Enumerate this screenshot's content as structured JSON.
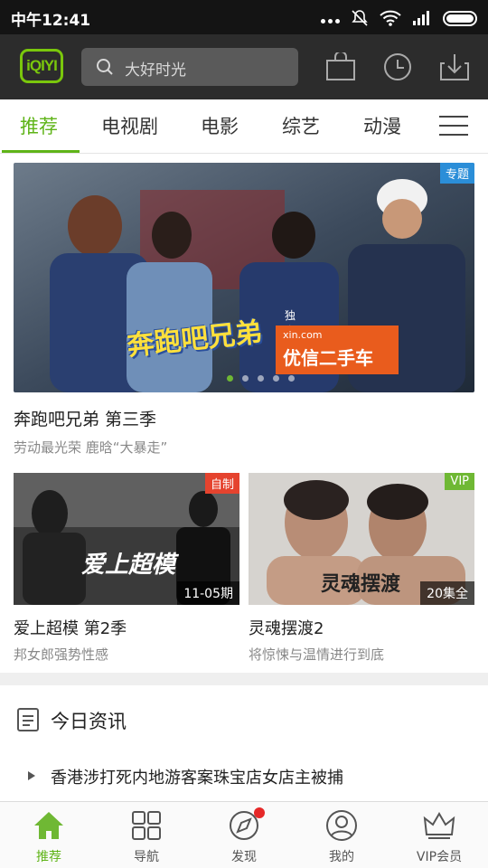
{
  "status_bar": {
    "time": "中午12:41"
  },
  "header": {
    "logo_text": "iQIYI",
    "search_placeholder": "大好时光"
  },
  "tabs": [
    {
      "label": "推荐",
      "active": true
    },
    {
      "label": "电视剧",
      "active": false
    },
    {
      "label": "电影",
      "active": false
    },
    {
      "label": "综艺",
      "active": false
    },
    {
      "label": "动漫",
      "active": false
    }
  ],
  "hero": {
    "badge": "专题",
    "sponsor_label": "独家冠名",
    "sponsor_url": "xin.com",
    "sponsor_name": "优信二手车",
    "show_logo": "奔跑吧兄弟",
    "title": "奔跑吧兄弟 第三季",
    "subtitle": "劳动最光荣 鹿晗“大暴走”",
    "pager_count": 5,
    "pager_active": 0
  },
  "cards": [
    {
      "badge": "自制",
      "episode_label": "11-05期",
      "title": "爱上超模 第2季",
      "subtitle": "邦女郎强势性感"
    },
    {
      "badge": "VIP",
      "episode_label": "20集全",
      "title": "灵魂摆渡2",
      "subtitle": "将惊悚与温情进行到底"
    }
  ],
  "news": {
    "title": "今日资讯",
    "items": [
      "香港涉打死内地游客案珠宝店女店主被捕"
    ]
  },
  "bottom_nav": [
    {
      "label": "推荐",
      "icon": "home-icon",
      "active": true
    },
    {
      "label": "导航",
      "icon": "grid-icon",
      "active": false
    },
    {
      "label": "发现",
      "icon": "compass-icon",
      "active": false
    },
    {
      "label": "我的",
      "icon": "user-icon",
      "active": false
    },
    {
      "label": "VIP会员",
      "icon": "crown-icon",
      "active": false
    }
  ],
  "colors": {
    "accent": "#5fb418",
    "header_bg": "#2c2c2c",
    "badge_blue": "#2b8ed8",
    "badge_red": "#e5432e",
    "badge_green": "#6fb834"
  }
}
